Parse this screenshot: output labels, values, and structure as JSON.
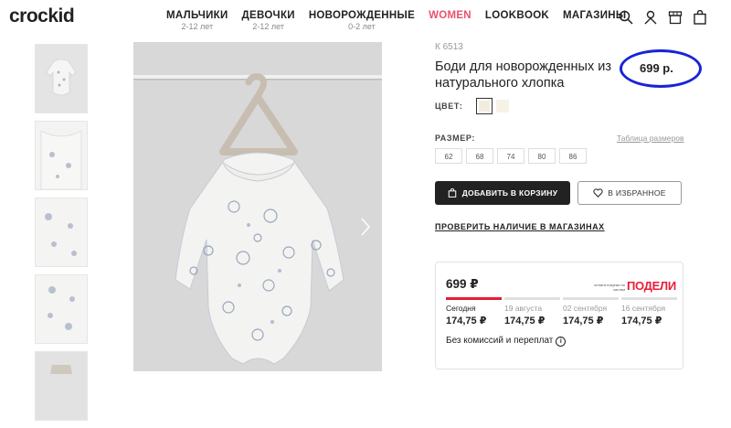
{
  "brand": {
    "logo_text": "crockid"
  },
  "nav": [
    {
      "label": "МАЛЬЧИКИ",
      "sub": "2-12 лет"
    },
    {
      "label": "ДЕВОЧКИ",
      "sub": "2-12 лет"
    },
    {
      "label": "НОВОРОЖДЕННЫЕ",
      "sub": "0-2 лет"
    },
    {
      "label": "WOMEN",
      "sub": ""
    },
    {
      "label": "LOOKBOOK",
      "sub": ""
    },
    {
      "label": "МАГАЗИНЫ",
      "sub": ""
    }
  ],
  "header_icons": [
    "search-icon",
    "user-icon",
    "store-icon",
    "bag-icon"
  ],
  "product": {
    "sku": "К 6513",
    "title": "Боди для новорожденных из натурального хлопка",
    "price": "699 р.",
    "color_label": "ЦВЕТ:",
    "size_label": "РАЗМЕР:",
    "size_table_link": "Таблица размеров",
    "sizes": [
      "62",
      "68",
      "74",
      "80",
      "86"
    ],
    "add_to_cart": "ДОБАВИТЬ В КОРЗИНУ",
    "add_to_favorites": "В ИЗБРАННОЕ",
    "check_stores": "ПРОВЕРИТЬ НАЛИЧИЕ В МАГАЗИНАХ"
  },
  "colors": {
    "accent_women": "#e8536b",
    "podeli_red": "#e31d36",
    "highlight_circle": "#1824d6",
    "button_dark": "#222222"
  },
  "podeli": {
    "price": "699 ₽",
    "logo_small": "оплата покупки по частям",
    "logo_big": "ПОДЕЛИ",
    "payments": [
      {
        "date": "Сегодня",
        "amount": "174,75 ₽"
      },
      {
        "date": "19 августа",
        "amount": "174,75 ₽"
      },
      {
        "date": "02 сентября",
        "amount": "174,75 ₽"
      },
      {
        "date": "16 сентября",
        "amount": "174,75 ₽"
      }
    ],
    "note": "Без комиссий и переплат",
    "info_glyph": "i"
  }
}
